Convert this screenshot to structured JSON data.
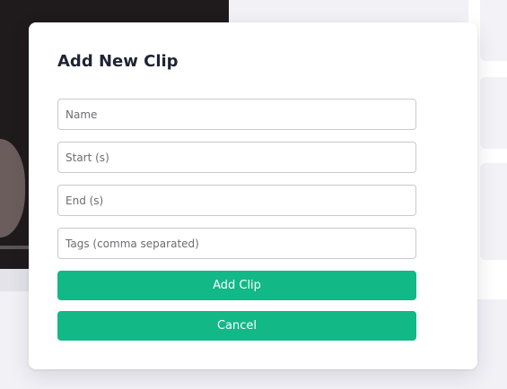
{
  "modal": {
    "title": "Add New Clip",
    "fields": {
      "name": {
        "placeholder": "Name",
        "value": ""
      },
      "start": {
        "placeholder": "Start (s)",
        "value": ""
      },
      "end": {
        "placeholder": "End (s)",
        "value": ""
      },
      "tags": {
        "placeholder": "Tags (comma separated)",
        "value": ""
      }
    },
    "buttons": {
      "add_label": "Add Clip",
      "cancel_label": "Cancel"
    }
  },
  "colors": {
    "accent": "#12b886",
    "title_text": "#1f2433",
    "page_background": "#f1f1f6",
    "video_background": "#1f1a1b"
  }
}
